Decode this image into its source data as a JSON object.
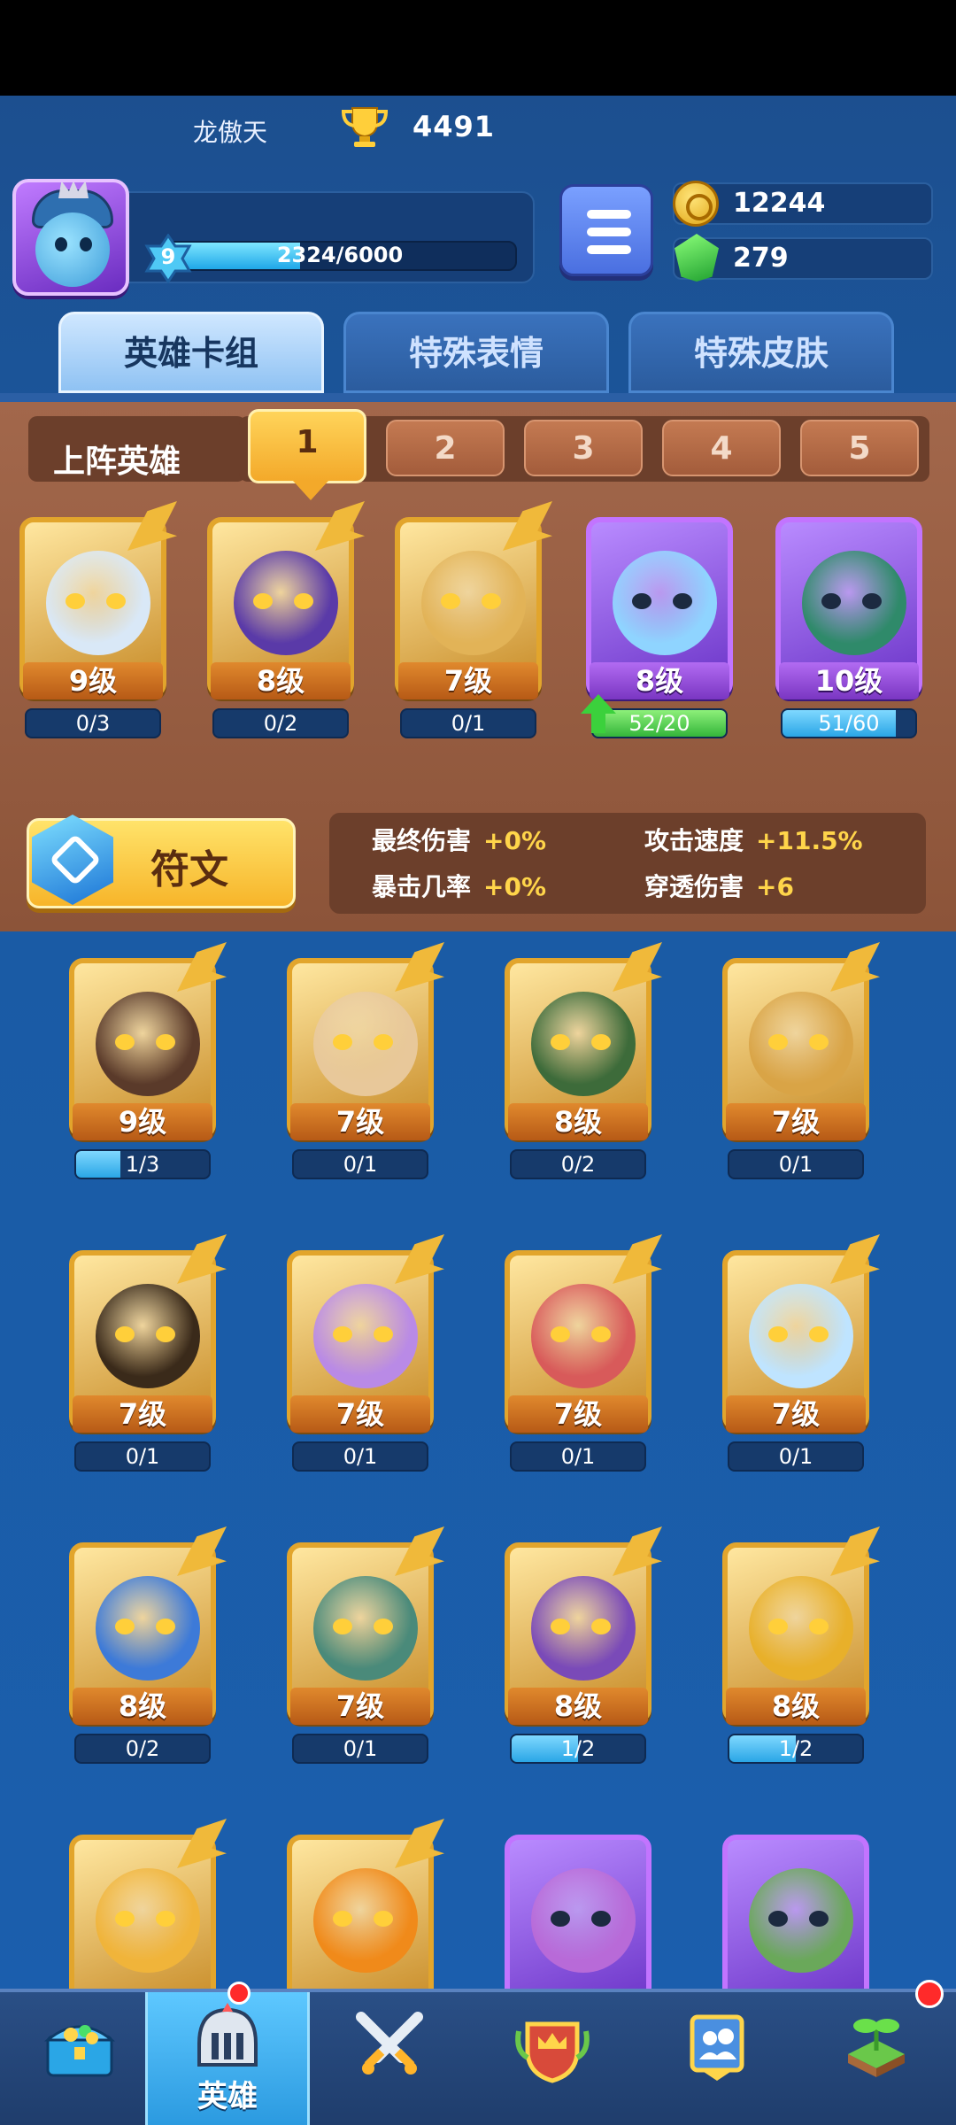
{
  "player": {
    "name": "龙傲天",
    "trophies": "4491",
    "level": "9",
    "xp_text": "2324/6000",
    "xp_fraction": 0.387
  },
  "currency": {
    "gold": "12244",
    "gems": "279"
  },
  "tabs": [
    {
      "label": "英雄卡组",
      "active": true
    },
    {
      "label": "特殊表情",
      "active": false
    },
    {
      "label": "特殊皮肤",
      "active": false
    }
  ],
  "deck": {
    "label": "上阵英雄",
    "numbers": [
      "1",
      "2",
      "3",
      "4",
      "5"
    ],
    "selected": "1",
    "heroes": [
      {
        "level": "9级",
        "progress": "0/3",
        "fraction": 0,
        "rarity": "legendary",
        "color": "#d9e8f7"
      },
      {
        "level": "8级",
        "progress": "0/2",
        "fraction": 0,
        "rarity": "legendary",
        "color": "#5a3aa8"
      },
      {
        "level": "7级",
        "progress": "0/1",
        "fraction": 0,
        "rarity": "legendary",
        "color": "#e2b357"
      },
      {
        "level": "8级",
        "progress": "52/20",
        "fraction": 1,
        "rarity": "epic",
        "color": "#8fd4ff",
        "upgrade": true
      },
      {
        "level": "10级",
        "progress": "51/60",
        "fraction": 0.85,
        "rarity": "epic",
        "color": "#2f8a6a"
      }
    ]
  },
  "rune": {
    "label": "符文",
    "stats": [
      {
        "name": "最终伤害",
        "value": "+0%"
      },
      {
        "name": "攻击速度",
        "value": "+11.5%"
      },
      {
        "name": "暴击几率",
        "value": "+0%"
      },
      {
        "name": "穿透伤害",
        "value": "+6"
      }
    ]
  },
  "collection": [
    {
      "level": "9级",
      "progress": "1/3",
      "fraction": 0.33,
      "rarity": "legendary",
      "color": "#5a3a2a"
    },
    {
      "level": "7级",
      "progress": "0/1",
      "fraction": 0,
      "rarity": "legendary",
      "color": "#e8c89a"
    },
    {
      "level": "8级",
      "progress": "0/2",
      "fraction": 0,
      "rarity": "legendary",
      "color": "#3d6b3a"
    },
    {
      "level": "7级",
      "progress": "0/1",
      "fraction": 0,
      "rarity": "legendary",
      "color": "#d9a446"
    },
    {
      "level": "7级",
      "progress": "0/1",
      "fraction": 0,
      "rarity": "legendary",
      "color": "#3a2a1a"
    },
    {
      "level": "7级",
      "progress": "0/1",
      "fraction": 0,
      "rarity": "legendary",
      "color": "#b98ae6"
    },
    {
      "level": "7级",
      "progress": "0/1",
      "fraction": 0,
      "rarity": "legendary",
      "color": "#d85a5a"
    },
    {
      "level": "7级",
      "progress": "0/1",
      "fraction": 0,
      "rarity": "legendary",
      "color": "#bfe4ff"
    },
    {
      "level": "8级",
      "progress": "0/2",
      "fraction": 0,
      "rarity": "legendary",
      "color": "#3d7ad8"
    },
    {
      "level": "7级",
      "progress": "0/1",
      "fraction": 0,
      "rarity": "legendary",
      "color": "#4a8a7a"
    },
    {
      "level": "8级",
      "progress": "1/2",
      "fraction": 0.5,
      "rarity": "legendary",
      "color": "#7a4ab8"
    },
    {
      "level": "8级",
      "progress": "1/2",
      "fraction": 0.5,
      "rarity": "legendary",
      "color": "#e8b02a"
    },
    {
      "level": "",
      "progress": "",
      "fraction": 0,
      "rarity": "legendary",
      "color": "#f0b43a"
    },
    {
      "level": "",
      "progress": "",
      "fraction": 0,
      "rarity": "legendary",
      "color": "#f08a1a"
    },
    {
      "level": "",
      "progress": "",
      "fraction": 0,
      "rarity": "epic",
      "color": "#b86ad8"
    },
    {
      "level": "",
      "progress": "",
      "fraction": 0,
      "rarity": "epic",
      "color": "#6aa85a"
    }
  ],
  "bottom_nav": [
    {
      "icon": "treasure-chest-icon",
      "label": "",
      "active": false
    },
    {
      "icon": "knight-helmet-icon",
      "label": "英雄",
      "active": true
    },
    {
      "icon": "crossed-swords-icon",
      "label": "",
      "active": false
    },
    {
      "icon": "crown-shield-icon",
      "label": "",
      "active": false
    },
    {
      "icon": "friends-icon",
      "label": "",
      "active": false
    },
    {
      "icon": "sprout-island-icon",
      "label": "",
      "active": false,
      "notification": true
    }
  ],
  "colors": {
    "gold_frame": "#e2a52c",
    "epic_frame": "#c274ff",
    "deck_panel": "#a2674b",
    "background": "#1b5fae",
    "stat_value": "#ffd54a"
  }
}
